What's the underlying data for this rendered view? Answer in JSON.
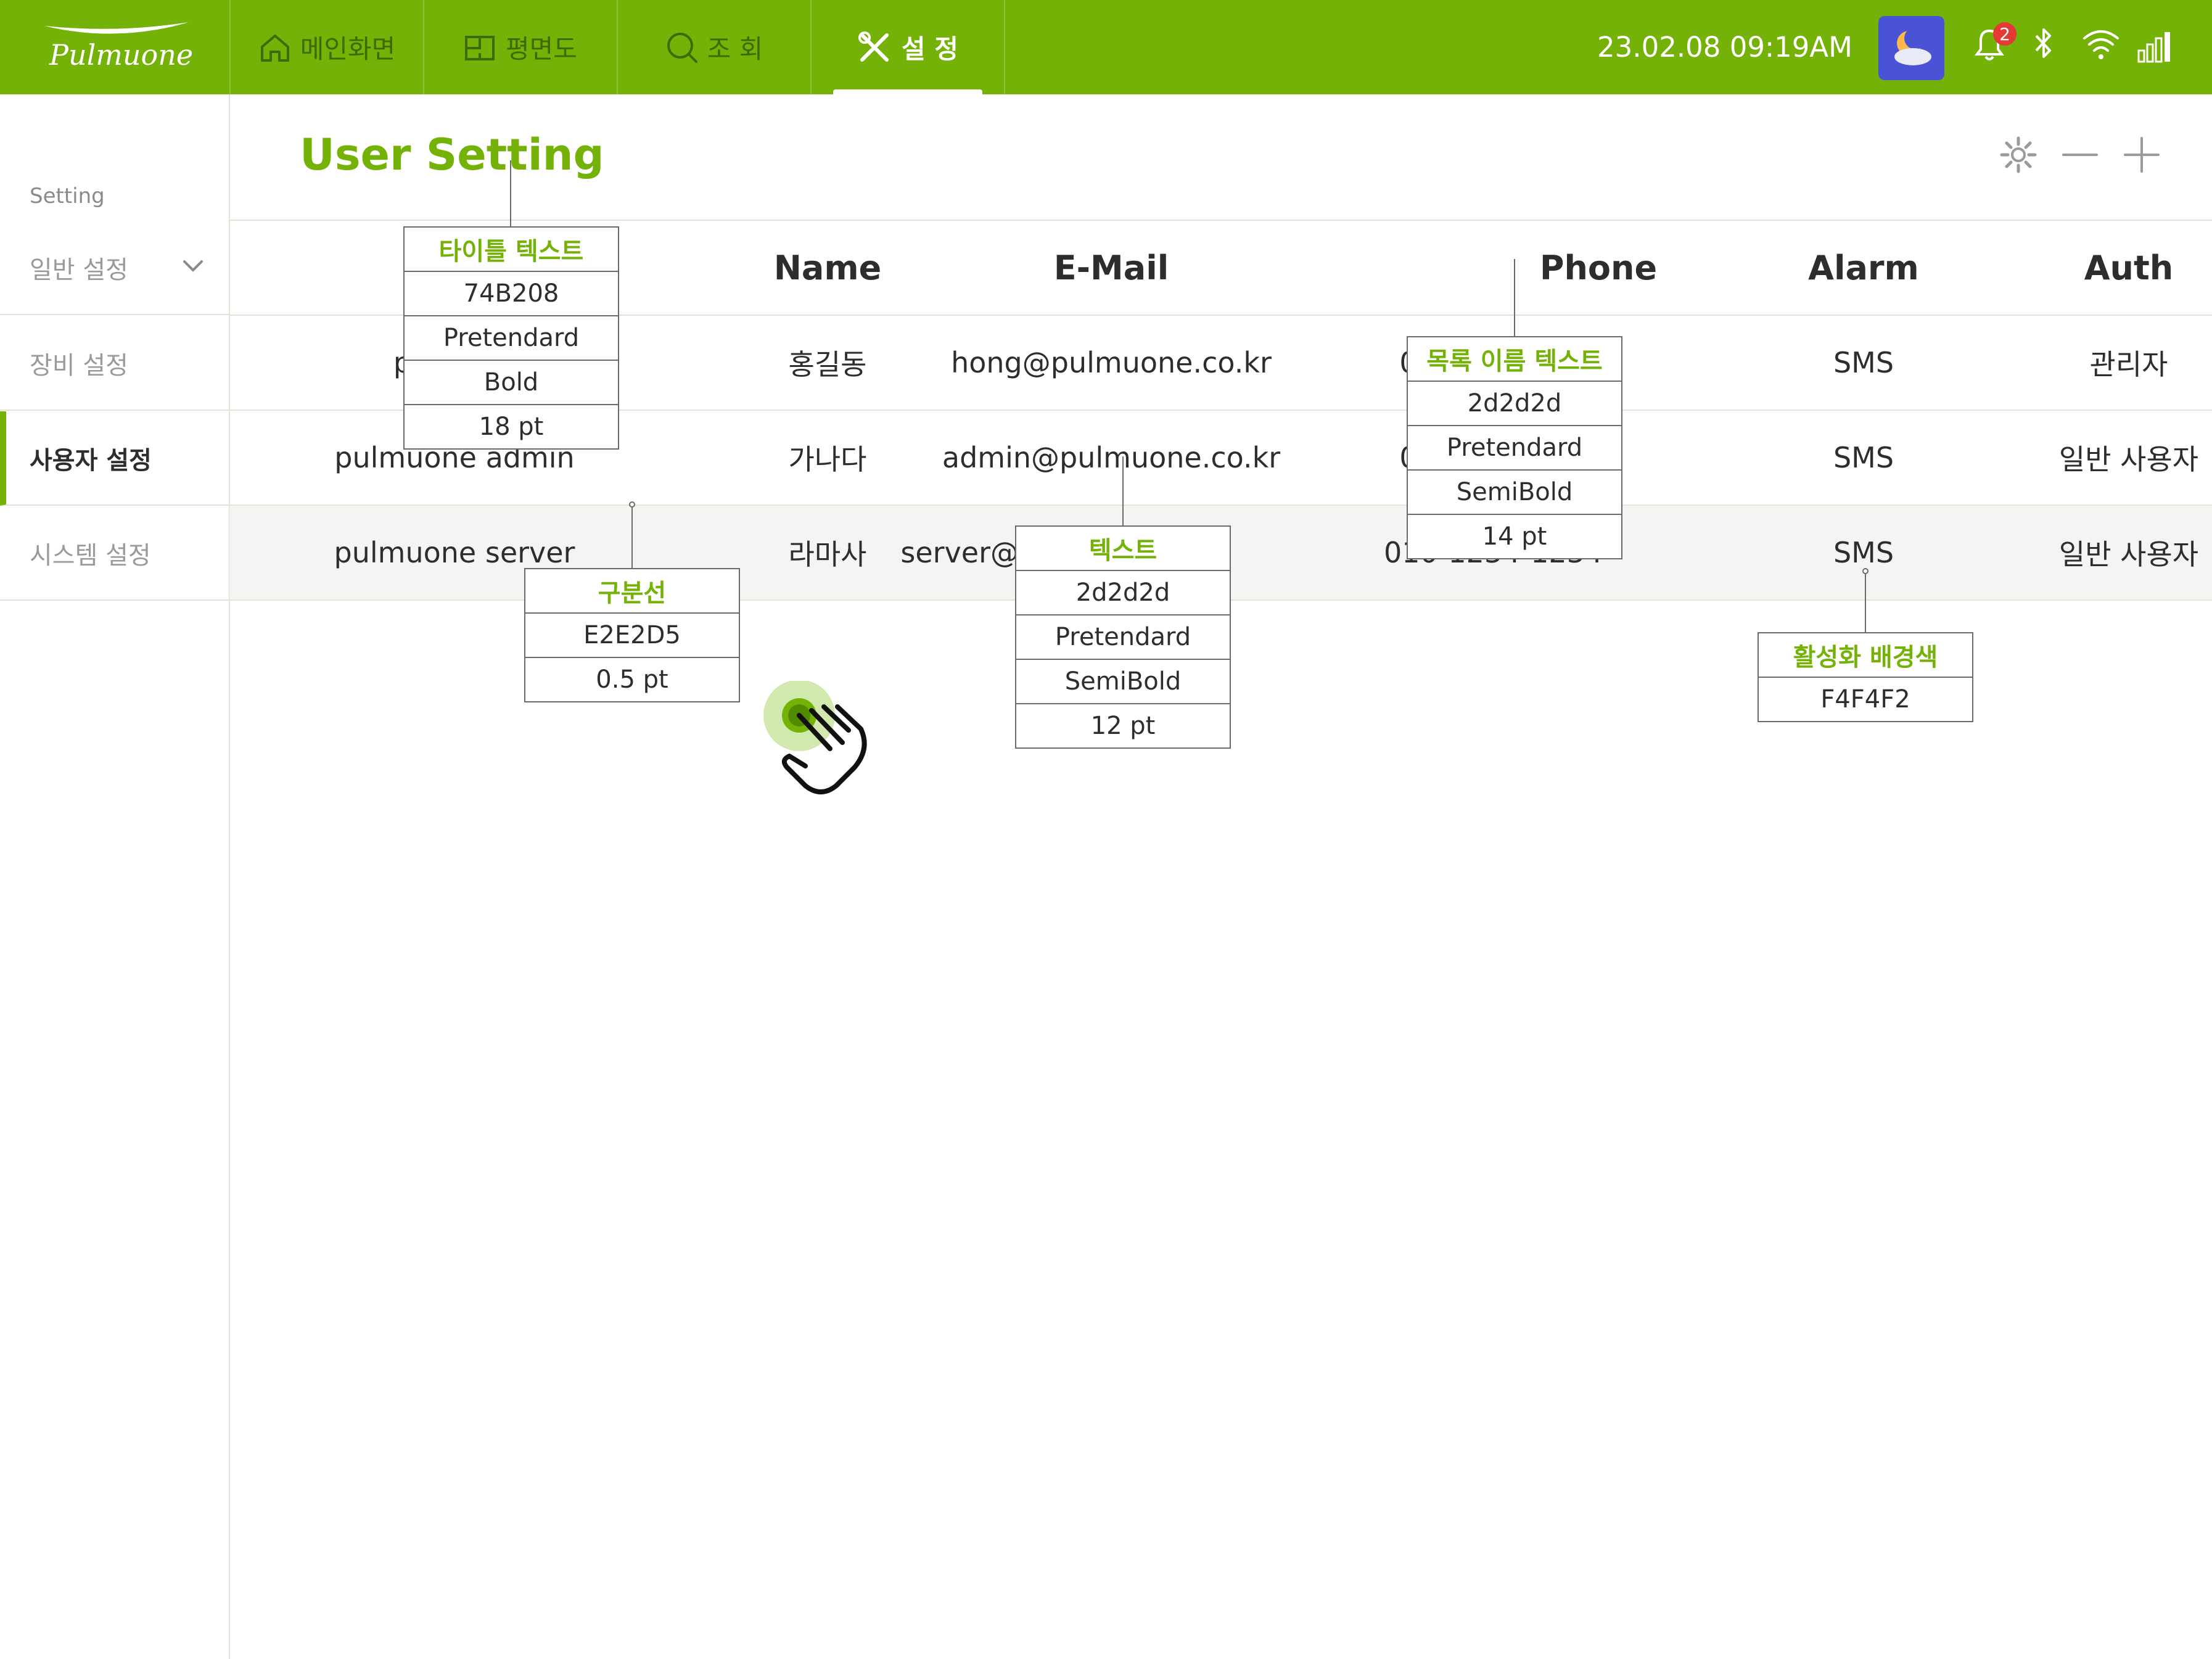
{
  "topbar": {
    "logo_text": "Pulmuone",
    "tabs": [
      {
        "label": "메인화면",
        "icon": "home-icon"
      },
      {
        "label": "평면도",
        "icon": "floorplan-icon"
      },
      {
        "label": "조 회",
        "icon": "search-icon"
      },
      {
        "label": "설 정",
        "icon": "tools-icon",
        "active": true
      }
    ],
    "datetime": "23.02.08  09:19AM",
    "weather_icon": "night-cloudy-icon",
    "notification_count": "2",
    "status_icons": [
      "bell-icon",
      "bluetooth-icon",
      "wifi-icon",
      "signal-icon"
    ]
  },
  "sidebar": {
    "caption": "Setting",
    "items": [
      {
        "label": "일반 설정",
        "expandable": true
      },
      {
        "label": "장비 설정"
      },
      {
        "label": "사용자 설정",
        "active": true
      },
      {
        "label": "시스템 설정"
      }
    ]
  },
  "page": {
    "title": "User Setting",
    "actions": [
      "gear-icon",
      "minus-icon",
      "plus-icon"
    ]
  },
  "table": {
    "columns": [
      "",
      "Name",
      "E-Mail",
      "Phone",
      "Alarm",
      "Auth"
    ],
    "rows": [
      {
        "id": "pu",
        "name": "홍길동",
        "email": "hong@pulmuone.co.kr",
        "phone": "0",
        "alarm": "SMS",
        "auth": "관리자"
      },
      {
        "id": "pulmuone admin",
        "name": "가나다",
        "email": "admin@pulmuone.co.kr",
        "phone": "0",
        "alarm": "SMS",
        "auth": "일반 사용자"
      },
      {
        "id": "pulmuone server",
        "name": "라마사",
        "email": "server@",
        "email_tail": "r",
        "phone": "010-1234-1234",
        "alarm": "SMS",
        "auth": "일반 사용자"
      }
    ]
  },
  "annotations": {
    "title_text": {
      "title": "타이틀 텍스트",
      "lines": [
        "74B208",
        "Pretendard",
        "Bold",
        "18 pt"
      ]
    },
    "list_name_text": {
      "title": "목록 이름 텍스트",
      "lines": [
        "2d2d2d",
        "Pretendard",
        "SemiBold",
        "14 pt"
      ]
    },
    "divider": {
      "title": "구분선",
      "lines": [
        "E2E2D5",
        "0.5 pt"
      ]
    },
    "text": {
      "title": "텍스트",
      "lines": [
        "2d2d2d",
        "Pretendard",
        "SemiBold",
        "12 pt"
      ]
    },
    "active_bg": {
      "title": "활성화 배경색",
      "lines": [
        "F4F4F2"
      ]
    }
  },
  "colors": {
    "brand": "#74B208",
    "text": "#2d2d2d",
    "divider": "#E2E2D5",
    "active_bg": "#F4F4F2"
  }
}
